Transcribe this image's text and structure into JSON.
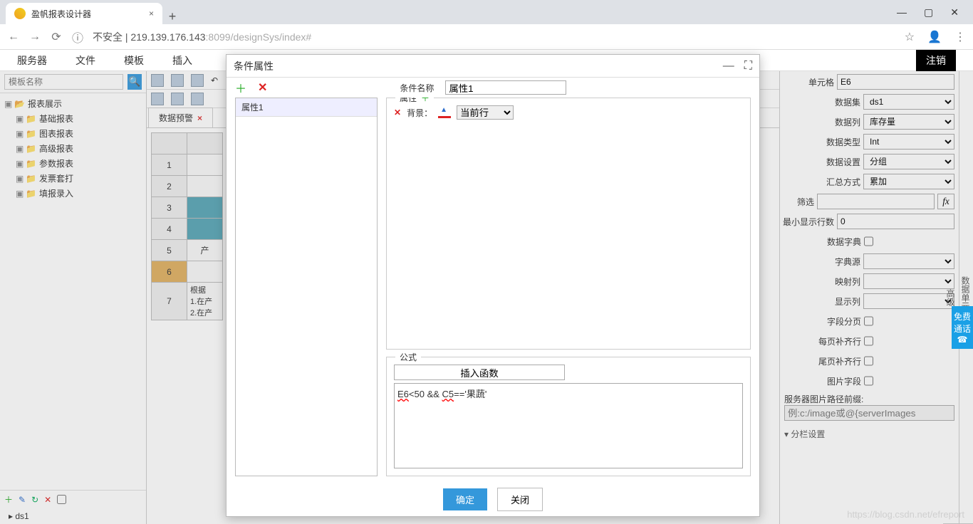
{
  "browser": {
    "tab_title": "盈帆报表设计器",
    "url_prefix": "不安全",
    "url_host": "219.139.176.143",
    "url_port": ":8099",
    "url_path": "/designSys/index#"
  },
  "menu": {
    "items": [
      "服务器",
      "文件",
      "模板",
      "插入"
    ],
    "logout": "注销"
  },
  "left": {
    "search_placeholder": "模板名称",
    "root": "报表展示",
    "children": [
      "基础报表",
      "图表报表",
      "高级报表",
      "参数报表",
      "发票套打",
      "填报录入"
    ],
    "ds_item": "ds1"
  },
  "center": {
    "tab_label": "数据预警",
    "row7_line0": "根据",
    "row7_line1": "1.在产",
    "row7_line2": "2.在产",
    "cell_b5": "产"
  },
  "right": {
    "cell_label": "单元格",
    "cell_value": "E6",
    "dataset_label": "数据集",
    "dataset_value": "ds1",
    "datacol_label": "数据列",
    "datacol_value": "库存量",
    "datatype_label": "数据类型",
    "datatype_value": "Int",
    "dataset_setting_label": "数据设置",
    "dataset_setting_value": "分组",
    "summary_label": "汇总方式",
    "summary_value": "累加",
    "filter_label": "筛选",
    "minrows_label": "最小显示行数",
    "minrows_value": "0",
    "dict_label": "数据字典",
    "dictsrc_label": "字典源",
    "mapcol_label": "映射列",
    "showcol_label": "显示列",
    "page_label": "字段分页",
    "fillpage_label": "每页补齐行",
    "filltail_label": "尾页补齐行",
    "imgfield_label": "图片字段",
    "server_img_label": "服务器图片路径前缀:",
    "server_img_placeholder": "例:c:/image或@{serverImages",
    "section_label": "分栏设置",
    "vtabs": [
      "数据单元格",
      "高级"
    ]
  },
  "modal": {
    "title": "条件属性",
    "name_label": "条件名称",
    "name_value": "属性1",
    "attr_label": "属性",
    "list_item": "属性1",
    "bg_label": "背景：",
    "bg_value": "当前行",
    "formula_label": "公式",
    "insert_fn": "插入函数",
    "formula_text": "E6<50 && C5=='果蔬'",
    "f_seg1": "E6",
    "f_seg2": "<50 && ",
    "f_seg3": "C5",
    "f_seg4": "=='果蔬'",
    "ok": "确定",
    "close": "关闭"
  },
  "call_badge": "免费通话",
  "watermark": "https://blog.csdn.net/efreport"
}
